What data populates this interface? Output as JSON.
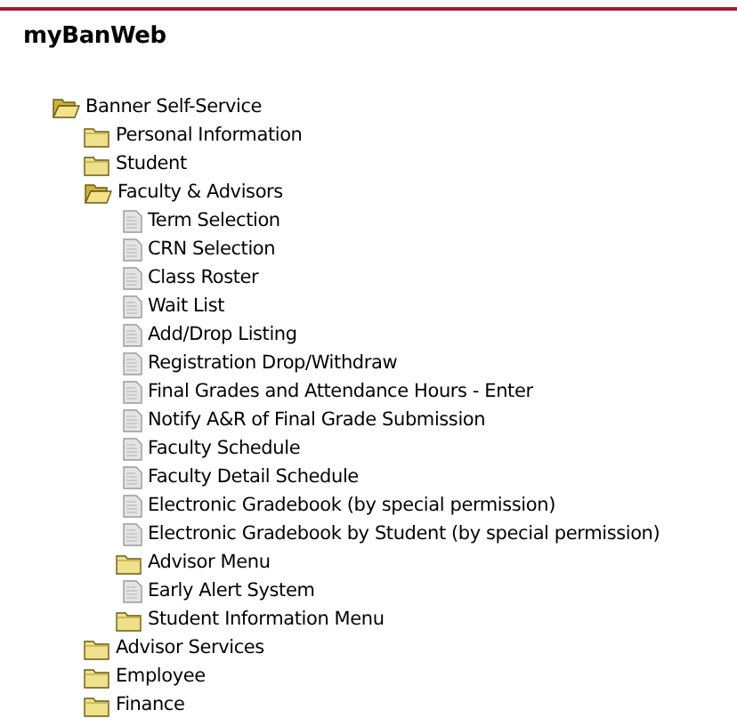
{
  "title": "myBanWeb",
  "tree": [
    {
      "label": "Banner Self-Service",
      "kind": "folder",
      "expanded": true,
      "children": [
        {
          "label": "Personal Information",
          "kind": "folder",
          "expanded": false
        },
        {
          "label": "Student",
          "kind": "folder",
          "expanded": false
        },
        {
          "label": "Faculty & Advisors",
          "kind": "folder",
          "expanded": true,
          "children": [
            {
              "label": "Term Selection",
              "kind": "page"
            },
            {
              "label": "CRN Selection",
              "kind": "page"
            },
            {
              "label": "Class Roster",
              "kind": "page"
            },
            {
              "label": "Wait List",
              "kind": "page"
            },
            {
              "label": "Add/Drop Listing",
              "kind": "page"
            },
            {
              "label": "Registration Drop/Withdraw",
              "kind": "page"
            },
            {
              "label": "Final Grades and Attendance Hours - Enter",
              "kind": "page"
            },
            {
              "label": "Notify A&R of Final Grade Submission",
              "kind": "page"
            },
            {
              "label": "Faculty Schedule",
              "kind": "page"
            },
            {
              "label": "Faculty Detail Schedule",
              "kind": "page"
            },
            {
              "label": "Electronic Gradebook (by special permission)",
              "kind": "page"
            },
            {
              "label": "Electronic Gradebook by Student (by special permission)",
              "kind": "page"
            },
            {
              "label": "Advisor Menu",
              "kind": "folder",
              "expanded": false
            },
            {
              "label": "Early Alert System",
              "kind": "page"
            },
            {
              "label": "Student Information Menu",
              "kind": "folder",
              "expanded": false
            }
          ]
        },
        {
          "label": "Advisor Services",
          "kind": "folder",
          "expanded": false
        },
        {
          "label": "Employee",
          "kind": "folder",
          "expanded": false
        },
        {
          "label": "Finance",
          "kind": "folder",
          "expanded": false
        }
      ]
    }
  ]
}
